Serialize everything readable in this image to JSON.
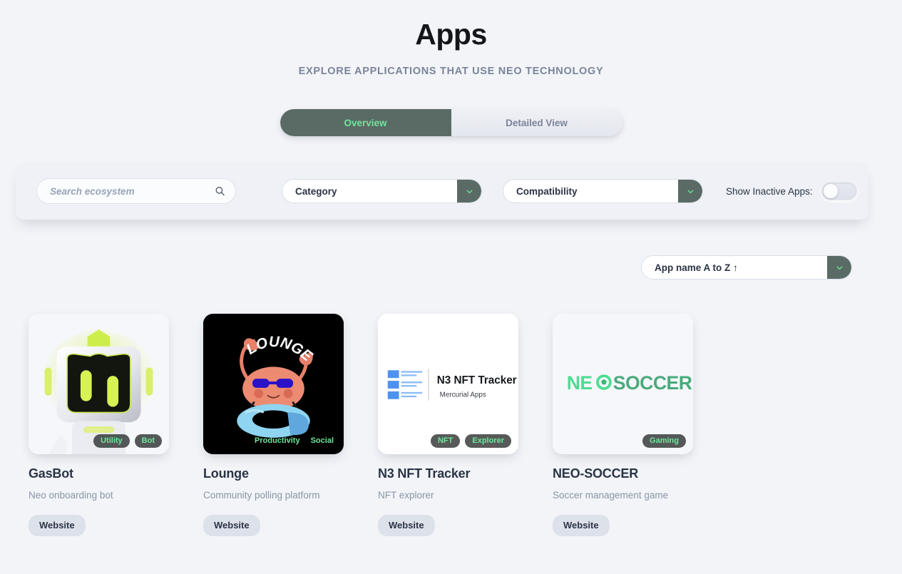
{
  "header": {
    "title": "Apps",
    "subtitle": "EXPLORE APPLICATIONS THAT USE NEO TECHNOLOGY"
  },
  "tabs": [
    {
      "label": "Overview",
      "active": true
    },
    {
      "label": "Detailed View",
      "active": false
    }
  ],
  "filters": {
    "search": {
      "placeholder": "Search ecosystem",
      "value": "",
      "icon": "search-icon"
    },
    "category": {
      "label": "Category",
      "icon": "chevron-down-icon"
    },
    "compatibility": {
      "label": "Compatibility",
      "icon": "chevron-down-icon"
    },
    "inactive_toggle": {
      "label": "Show Inactive Apps:",
      "on": false
    }
  },
  "sort": {
    "label": "App name A to Z ↑",
    "icon": "chevron-down-icon"
  },
  "colors": {
    "page_bg": "#f2f4f8",
    "accent_green": "#6ee79a",
    "slate_green": "#5a6b66",
    "title_navy": "#2b3445",
    "muted": "#8b94a6"
  },
  "cards": [
    {
      "name": "GasBot",
      "description": "Neo onboarding bot",
      "tags": [
        "Utility",
        "Bot"
      ],
      "website_label": "Website",
      "logo": "gasbot-robot-logo",
      "tile_style": "grayish"
    },
    {
      "name": "Lounge",
      "description": "Community polling platform",
      "tags": [
        "Productivity",
        "Social"
      ],
      "website_label": "Website",
      "logo": "lounge-crab-logo",
      "logo_text": "LOUNGE",
      "tile_style": "black"
    },
    {
      "name": "N3 NFT Tracker",
      "description": "NFT explorer",
      "tags": [
        "NFT",
        "Explorer"
      ],
      "website_label": "Website",
      "logo": "n3-nft-tracker-logo",
      "logo_text": "N3 NFT Tracker",
      "logo_subtext": "Mercurial Apps",
      "tile_style": "white"
    },
    {
      "name": "NEO-SOCCER",
      "description": "Soccer management game",
      "tags": [
        "Gaming"
      ],
      "website_label": "Website",
      "logo": "neo-soccer-logo",
      "logo_text": "NEOSOCCER",
      "tile_style": "grayish"
    }
  ]
}
